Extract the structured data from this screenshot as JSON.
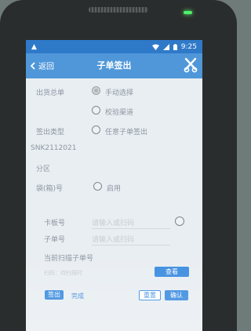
{
  "status_bar": {
    "warning_icon": "warning-triangle",
    "icons": [
      "wifi-icon",
      "signal-icon",
      "battery-icon"
    ],
    "time": "9:25"
  },
  "app_bar": {
    "back_label": "返回",
    "title": "子单签出",
    "close_icon": "scissors-x-icon"
  },
  "form": {
    "outbound_label": "出货总单",
    "manual_select": "手动选择",
    "verify_channel": "校验渠道",
    "checkout_type_label": "签出类型",
    "any_sub_order": "任意子单签出",
    "order_number": "SNK2112021",
    "zone_label": "分区",
    "box_label": "袋(箱)号",
    "enable_label": "启用",
    "card_board_label": "卡板号",
    "card_board_placeholder": "请输入或扫码",
    "sub_order_label": "子单号",
    "sub_order_placeholder": "请输入或扫码",
    "current_scan_label": "当前扫描子单号",
    "scan_status": "扫码：待扫描时",
    "query_button": "查看"
  },
  "bottom": {
    "checkout_button": "签出",
    "complete_label": "完成",
    "reset_button": "重置",
    "confirm_button": "确认"
  },
  "colors": {
    "status_bar": "#2f79c9",
    "title_bar": "#4f97d9",
    "accent": "#3f8ee0",
    "screen_bg": "#e9eef2"
  }
}
